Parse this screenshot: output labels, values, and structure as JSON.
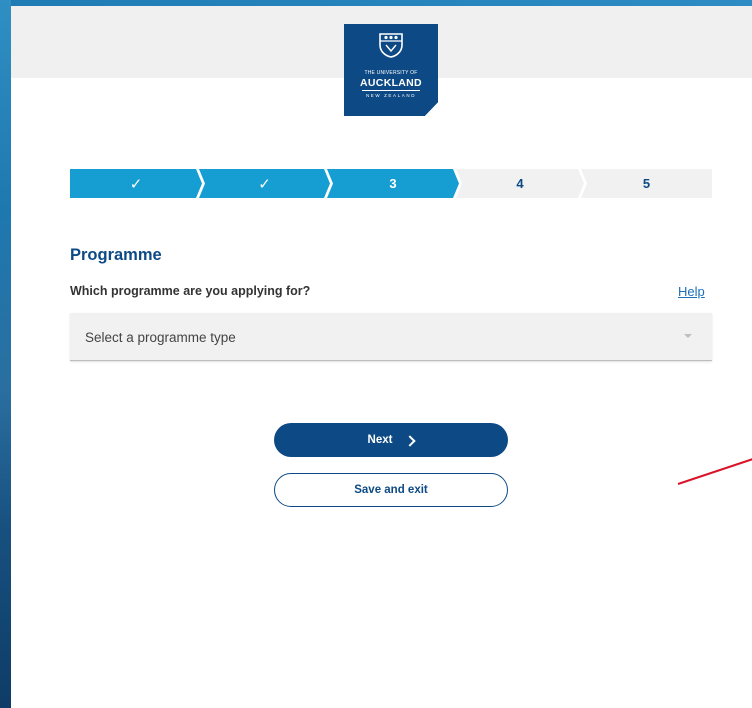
{
  "header": {
    "logo": {
      "line1": "THE UNIVERSITY OF",
      "line2": "AUCKLAND",
      "line3": "NEW ZEALAND",
      "color": "#0d4a85"
    }
  },
  "stepper": {
    "steps": [
      {
        "label": "✓",
        "state": "done"
      },
      {
        "label": "✓",
        "state": "done"
      },
      {
        "label": "3",
        "state": "current"
      },
      {
        "label": "4",
        "state": "todo"
      },
      {
        "label": "5",
        "state": "todo"
      }
    ],
    "active_color": "#169dd1",
    "inactive_color": "#f1f1f1"
  },
  "form": {
    "section_title": "Programme",
    "question": "Which programme are you applying for?",
    "help_label": "Help",
    "select_placeholder": "Select a programme type"
  },
  "actions": {
    "next_label": "Next",
    "save_label": "Save and exit"
  },
  "annotation": {
    "color": "#d9142a",
    "icon": "red-annotation-arrow-icon"
  }
}
